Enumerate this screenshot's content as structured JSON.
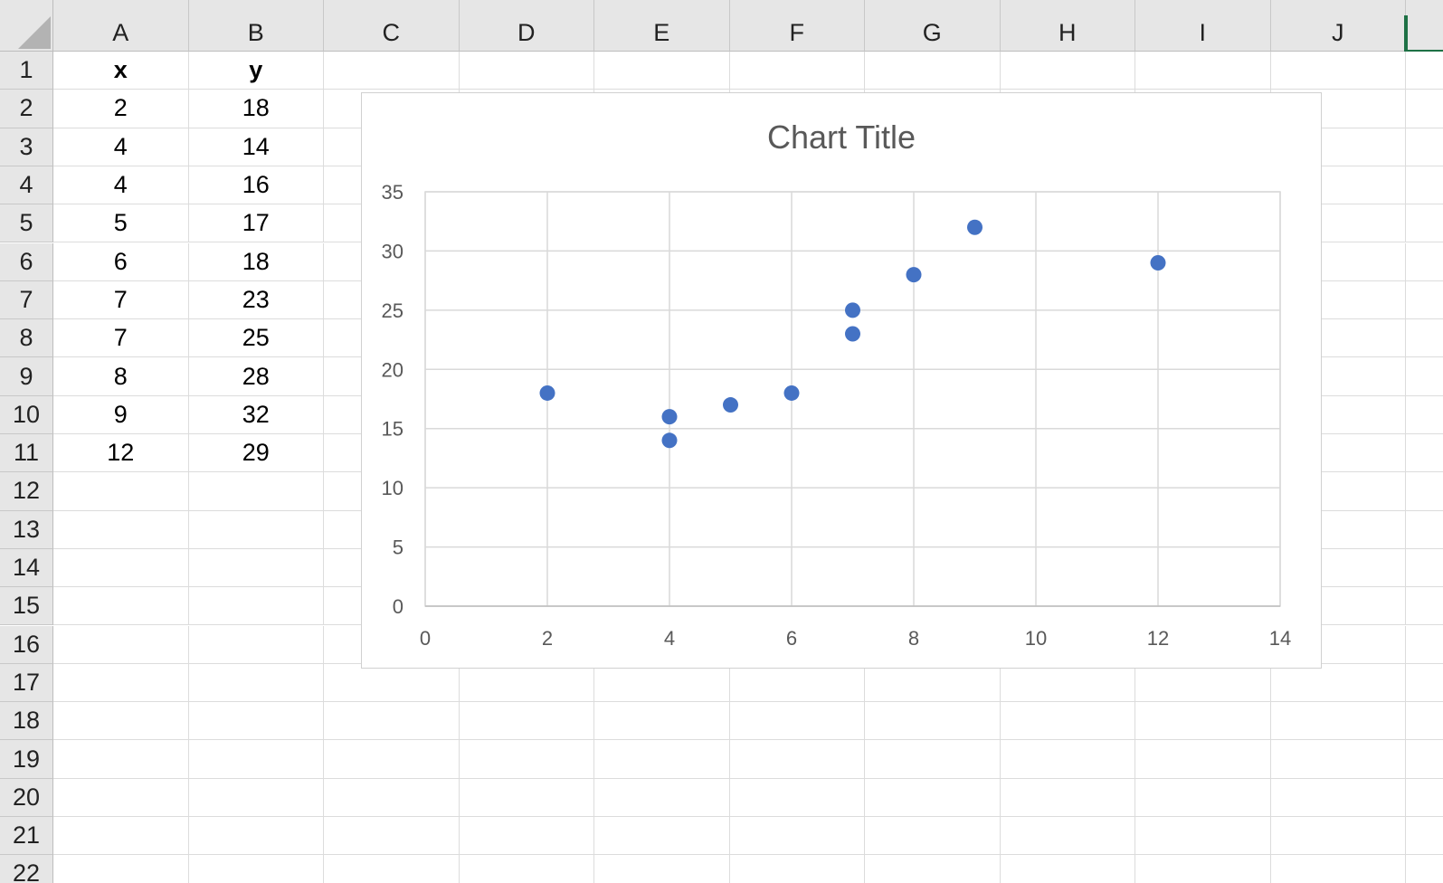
{
  "sheet": {
    "columns": [
      "A",
      "B",
      "C",
      "D",
      "E",
      "F",
      "G",
      "H",
      "I",
      "J"
    ],
    "rows": [
      "1",
      "2",
      "3",
      "4",
      "5",
      "6",
      "7",
      "8",
      "9",
      "10",
      "11",
      "12",
      "13",
      "14",
      "15",
      "16",
      "17",
      "18",
      "19",
      "20",
      "21",
      "22"
    ],
    "header": {
      "x": "x",
      "y": "y"
    },
    "table": [
      {
        "x": "2",
        "y": "18"
      },
      {
        "x": "4",
        "y": "14"
      },
      {
        "x": "4",
        "y": "16"
      },
      {
        "x": "5",
        "y": "17"
      },
      {
        "x": "6",
        "y": "18"
      },
      {
        "x": "7",
        "y": "23"
      },
      {
        "x": "7",
        "y": "25"
      },
      {
        "x": "8",
        "y": "28"
      },
      {
        "x": "9",
        "y": "32"
      },
      {
        "x": "12",
        "y": "29"
      }
    ]
  },
  "chart_data": {
    "type": "scatter",
    "title": "Chart Title",
    "xlabel": "",
    "ylabel": "",
    "xlim": [
      0,
      14
    ],
    "ylim": [
      0,
      35
    ],
    "x_ticks": [
      0,
      2,
      4,
      6,
      8,
      10,
      12,
      14
    ],
    "y_ticks": [
      0,
      5,
      10,
      15,
      20,
      25,
      30,
      35
    ],
    "grid": true,
    "legend": "none",
    "marker_color": "#4472c4",
    "series": [
      {
        "x": [
          2,
          4,
          4,
          5,
          6,
          7,
          7,
          8,
          9,
          12
        ],
        "y": [
          18,
          14,
          16,
          17,
          18,
          23,
          25,
          28,
          32,
          29
        ]
      }
    ]
  }
}
